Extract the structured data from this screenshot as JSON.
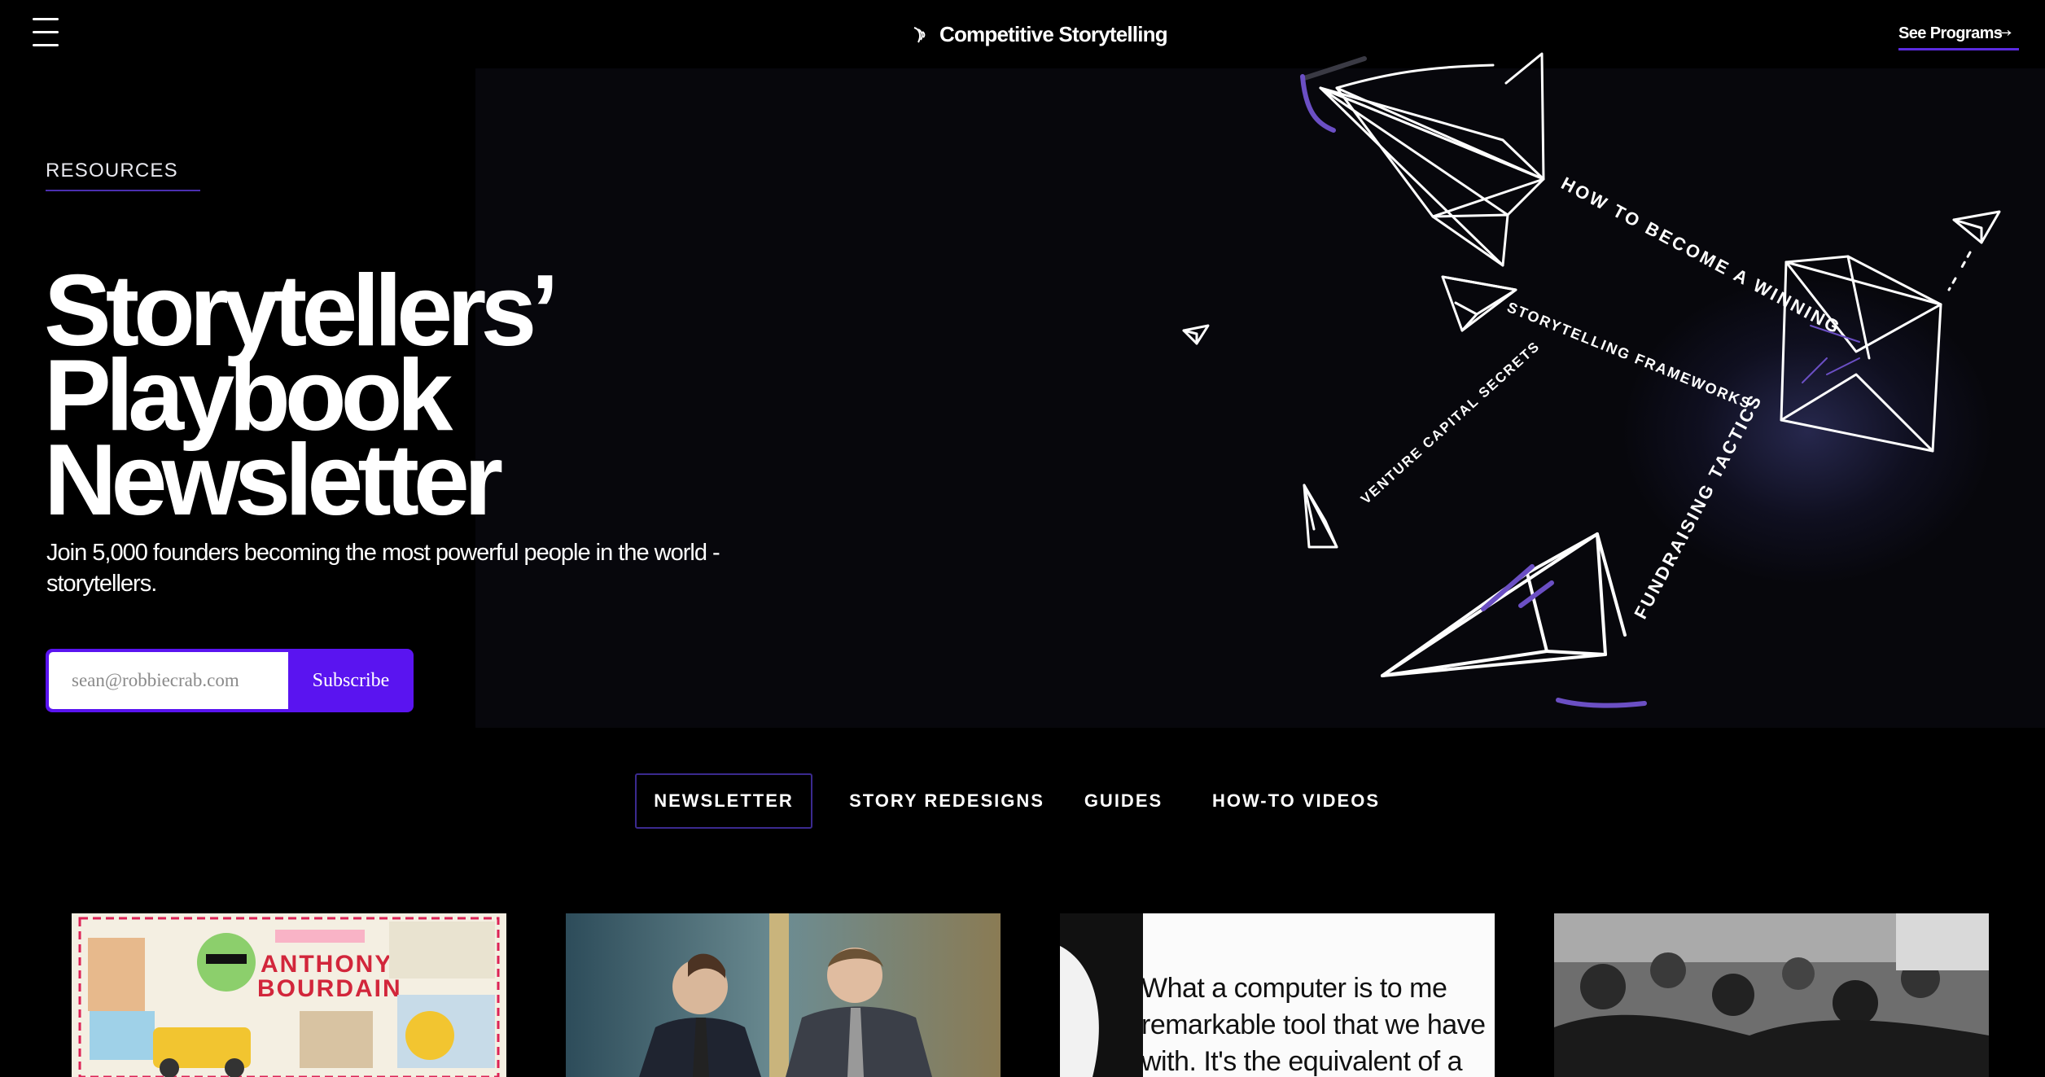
{
  "header": {
    "brand": "Competitive Storytelling",
    "cta_label": "See Programs",
    "cta_arrow": "→"
  },
  "hero": {
    "eyebrow": "RESOURCES",
    "title_lines": [
      "Storytellers’",
      "Playbook",
      "Newsletter"
    ],
    "subtitle": "Join 5,000 founders becoming the most powerful people in the world - storytellers.",
    "art_labels": {
      "winning": "HOW TO BECOME A WINNING",
      "frameworks": "STORYTELLING FRAMEWORKS",
      "vc": "VENTURE CAPITAL SECRETS",
      "fundraising": "FUNDRAISING TACTICS"
    }
  },
  "subscribe": {
    "placeholder": "sean@robbiecrab.com",
    "button_label": "Subscribe"
  },
  "tabs": [
    {
      "label": "NEWSLETTER",
      "active": true
    },
    {
      "label": "STORY REDESIGNS",
      "active": false
    },
    {
      "label": "GUIDES",
      "active": false
    },
    {
      "label": "HOW-TO VIDEOS",
      "active": false
    }
  ],
  "cards": [
    {
      "image": "anthony-bourdain-illustration",
      "image_text_1": "ANTHONY",
      "image_text_2": "BOURDAIN"
    },
    {
      "image": "two-men-in-suits-photo"
    },
    {
      "image": "quote-card",
      "quote_lines": [
        "What a computer is to me",
        "remarkable tool that we have",
        "with. It's the equivalent of a"
      ]
    },
    {
      "image": "black-and-white-crowd-photo"
    }
  ],
  "colors": {
    "accent": "#5a14f0",
    "underline": "#4b2fb0",
    "tab_border": "#3b2a8f",
    "background": "#000000",
    "hero_panel": "#07070c"
  },
  "icons": {
    "menu": "hamburger-icon",
    "brand": "sound-wave-icon",
    "cta": "arrow-right-icon"
  }
}
